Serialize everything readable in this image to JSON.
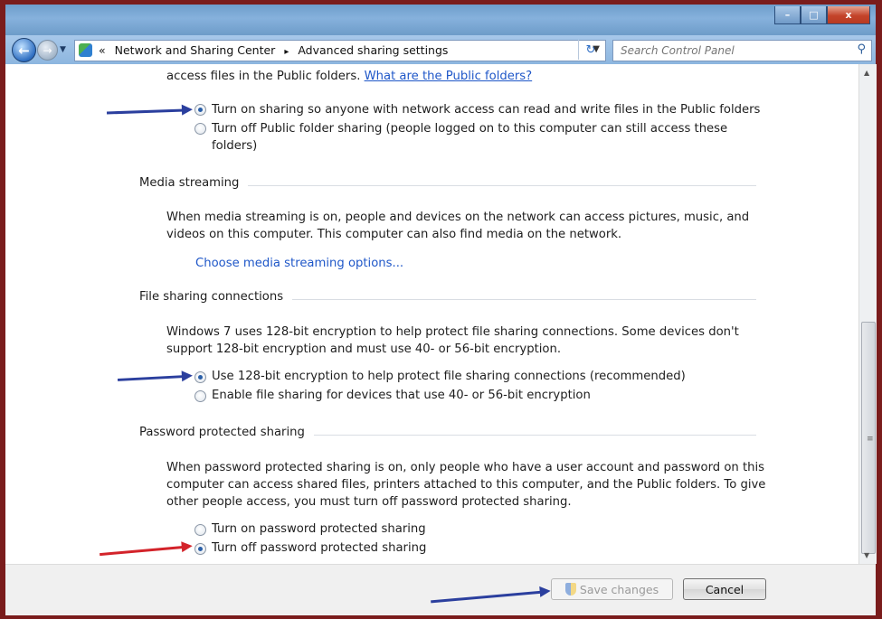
{
  "search": {
    "placeholder": "Search Control Panel"
  },
  "address": {
    "overflow": "«",
    "crumbs": [
      "Network and Sharing Center",
      "Advanced sharing settings"
    ],
    "separator": "▸"
  },
  "public_folders": {
    "intro": "access files in the Public folders.",
    "intro_link": "What are the Public folders?",
    "options": [
      {
        "label": "Turn on sharing so anyone with network access can read and write files in the Public folders",
        "checked": true
      },
      {
        "label": "Turn off Public folder sharing (people logged on to this computer can still access these",
        "label_line2": "folders)",
        "checked": false
      }
    ]
  },
  "media_streaming": {
    "title": "Media streaming",
    "desc_line1": "When media streaming is on, people and devices on the network can access pictures, music, and",
    "desc_line2": "videos on this computer. This computer can also find media on the network.",
    "link": "Choose media streaming options..."
  },
  "file_sharing": {
    "title": "File sharing connections",
    "desc_line1": "Windows 7 uses 128-bit encryption to help protect file sharing connections. Some devices don't",
    "desc_line2": "support 128-bit encryption and must use 40- or 56-bit encryption.",
    "options": [
      {
        "label": "Use 128-bit encryption to help protect file sharing connections (recommended)",
        "checked": true
      },
      {
        "label": "Enable file sharing for devices that use 40- or 56-bit encryption",
        "checked": false
      }
    ]
  },
  "password_sharing": {
    "title": "Password protected sharing",
    "desc_line1": "When password protected sharing is on, only people who have a user account and password on this",
    "desc_line2": "computer can access shared files, printers attached to this computer, and the Public folders. To give",
    "desc_line3": "other people access, you must turn off password protected sharing.",
    "options": [
      {
        "label": "Turn on password protected sharing",
        "checked": false
      },
      {
        "label": "Turn off password protected sharing",
        "checked": true
      }
    ]
  },
  "footer": {
    "save_label": "Save changes",
    "cancel_label": "Cancel"
  },
  "colors": {
    "annotation_blue": "#2b3f9e",
    "annotation_red": "#d3232a",
    "link": "#1f57c8"
  }
}
